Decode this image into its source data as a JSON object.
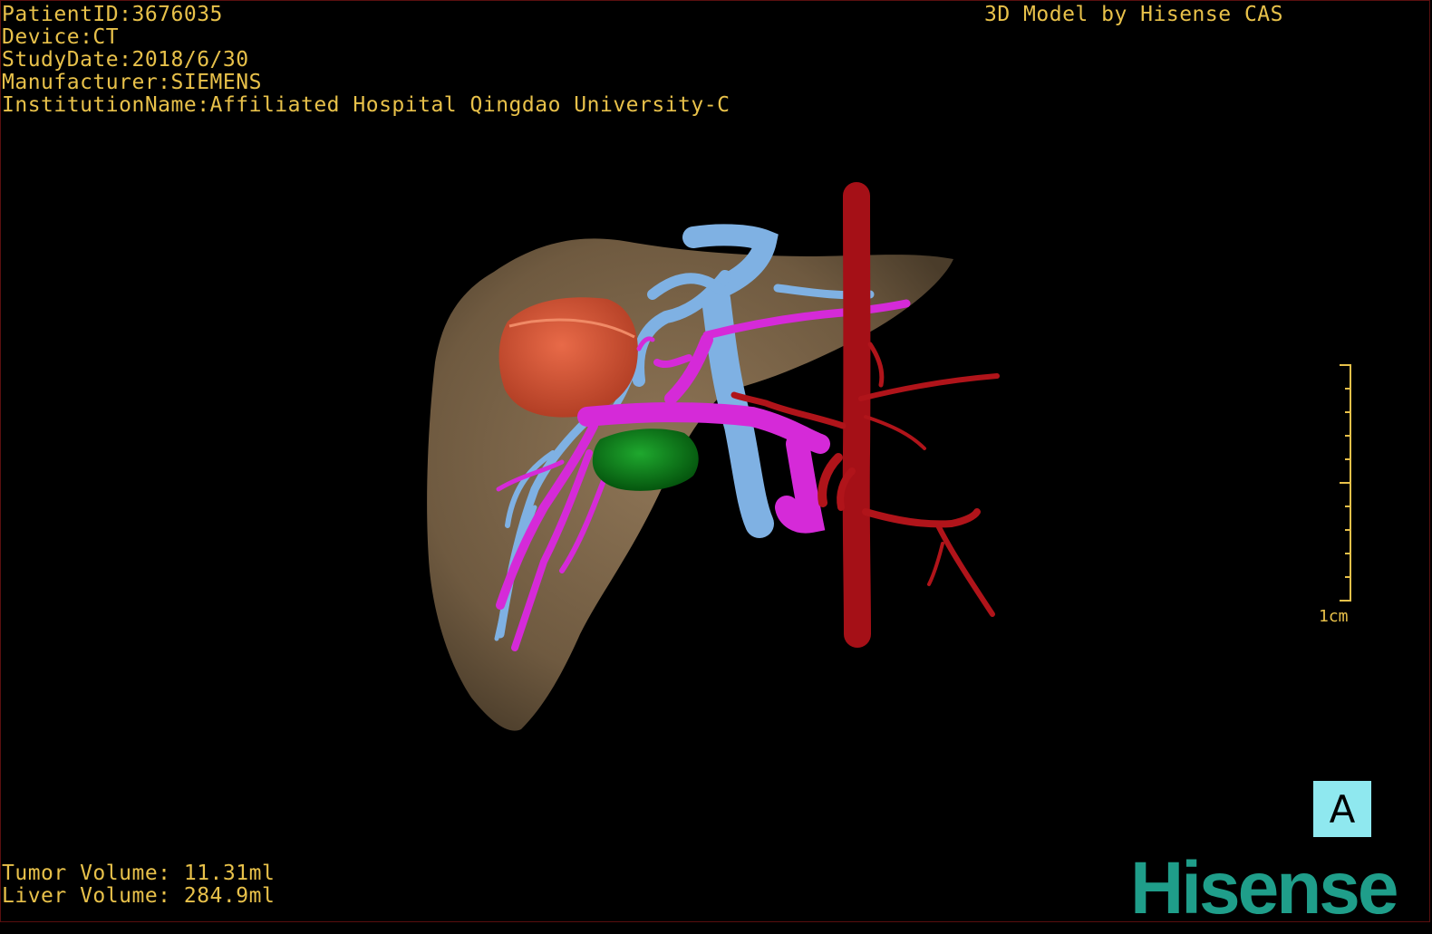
{
  "header": {
    "patient_id": "PatientID:3676035",
    "device": "Device:CT",
    "study_date": "StudyDate:2018/6/30",
    "manufacturer": "Manufacturer:SIEMENS",
    "institution": "InstitutionName:Affiliated Hospital Qingdao University-C",
    "model_credit": "3D Model by Hisense CAS"
  },
  "footer": {
    "tumor_volume": "Tumor Volume: 11.31ml",
    "liver_volume": "Liver Volume: 284.9ml"
  },
  "scale": {
    "label": "1cm"
  },
  "orientation": {
    "label": "A",
    "color": "#8fe8ef"
  },
  "brand": {
    "name": "Hisense",
    "color": "#1f9e8a"
  },
  "colors": {
    "text": "#e8c14a",
    "liver": "#7b6347",
    "tumor": "#d75a3c",
    "hepatic_vein": "#7fb1e3",
    "portal_vein": "#d52ad8",
    "artery": "#b0141a",
    "gallbladder": "#0f8a1c"
  }
}
